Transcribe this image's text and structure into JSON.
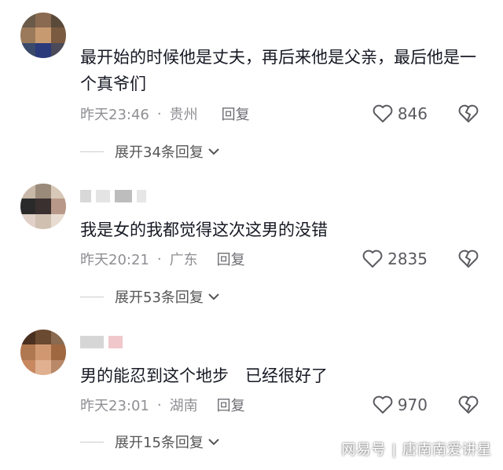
{
  "comments": [
    {
      "text": "最开始的时候他是丈夫，再后来他是父亲，最后他是一个真爷们",
      "time": "昨天23:46",
      "location": "贵州",
      "reply_label": "回复",
      "likes": "846",
      "expand": "展开34条回复"
    },
    {
      "text": "我是女的我都觉得这次这男的没错",
      "time": "昨天20:21",
      "location": "广东",
      "reply_label": "回复",
      "likes": "2835",
      "expand": "展开53条回复"
    },
    {
      "text": "男的能忍到这个地步　已经很好了",
      "time": "昨天23:01",
      "location": "湖南",
      "reply_label": "回复",
      "likes": "970",
      "expand": "展开15条回复"
    }
  ],
  "watermark": "网易号 | 唐南南爱讲星",
  "icons": {
    "like": "heart-icon",
    "dislike": "broken-heart-icon",
    "expand": "chevron-down-icon"
  },
  "colors": {
    "text": "#161823",
    "meta": "#8f8f94",
    "icon": "#5a5a60"
  }
}
